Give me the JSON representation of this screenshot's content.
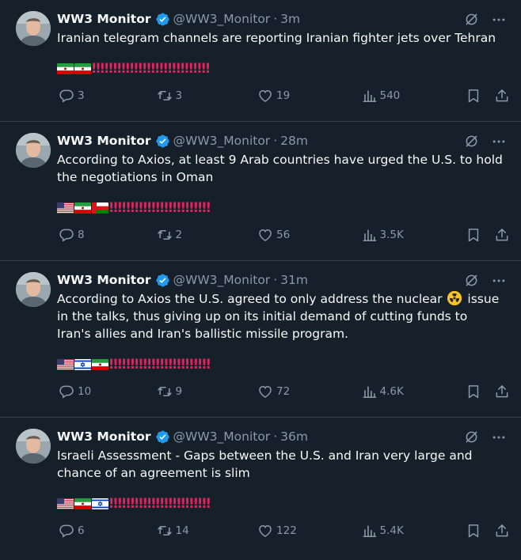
{
  "colors": {
    "background": "#15202b",
    "border": "#38444d",
    "text": "#f7f9f9",
    "muted": "#8b98a5",
    "verified": "#1d9bf0",
    "exclamation": "#e0245e"
  },
  "tweets": [
    {
      "name": "WW3 Monitor",
      "handle": "@WW3_Monitor",
      "separator": "·",
      "time": "3m",
      "text": "Iranian telegram channels are reporting Iranian fighter jets over Tehran",
      "flags": [
        "iran-flag",
        "iran-flag"
      ],
      "marks": "‼‼‼‼‼‼‼‼‼‼‼‼‼‼",
      "replies": "3",
      "reposts": "3",
      "likes": "19",
      "views": "540"
    },
    {
      "name": "WW3 Monitor",
      "handle": "@WW3_Monitor",
      "separator": "·",
      "time": "28m",
      "text": "According to Axios, at least 9 Arab countries have urged the U.S. to hold the negotiations in Oman",
      "flags": [
        "us-flag",
        "iran-flag",
        "oman-flag"
      ],
      "marks": "‼‼‼‼‼‼‼‼‼‼‼‼",
      "replies": "8",
      "reposts": "2",
      "likes": "56",
      "views": "3.5K"
    },
    {
      "name": "WW3 Monitor",
      "handle": "@WW3_Monitor",
      "separator": "·",
      "time": "31m",
      "text_before": "According to Axios the U.S. agreed to only address the nuclear ",
      "text_after": " issue in the talks, thus giving up on its initial demand of cutting funds to Iran's allies and Iran's ballistic missile program.",
      "inline_icon": "radioactive-icon",
      "flags": [
        "us-flag",
        "israel-flag",
        "iran-flag"
      ],
      "marks": "‼‼‼‼‼‼‼‼‼‼‼‼",
      "replies": "10",
      "reposts": "9",
      "likes": "72",
      "views": "4.6K"
    },
    {
      "name": "WW3 Monitor",
      "handle": "@WW3_Monitor",
      "separator": "·",
      "time": "36m",
      "text": "Israeli Assessment - Gaps between the U.S. and Iran very large and chance of an agreement is slim",
      "flags": [
        "us-flag",
        "iran-flag",
        "israel-flag"
      ],
      "marks": "‼‼‼‼‼‼‼‼‼‼‼‼",
      "replies": "6",
      "reposts": "14",
      "likes": "122",
      "views": "5.4K"
    }
  ]
}
